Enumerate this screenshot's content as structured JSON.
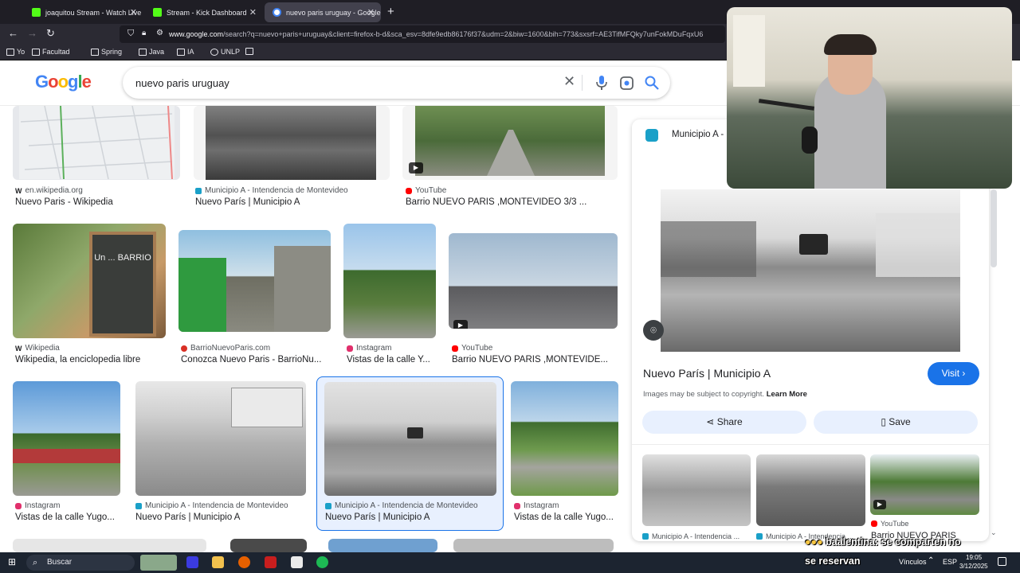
{
  "browser": {
    "tabs": [
      {
        "label": "joaquitou Stream - Watch Live o...",
        "color": "#53fc18"
      },
      {
        "label": "Stream - Kick Dashboard",
        "color": "#53fc18"
      },
      {
        "label": "nuevo paris uruguay - Google S...",
        "color": "#4285f4"
      }
    ],
    "url_domain": "www.google.com",
    "url_rest": "/search?q=nuevo+paris+uruguay&client=firefox-b-d&sca_esv=8dfe9edb86176f37&udm=2&biw=1600&bih=773&sxsrf=AE3TifMFQky7unFokMDuFqxU6",
    "bookmarks": [
      "Yo",
      "Facultad",
      "Spring",
      "Java",
      "IA",
      "UNLP"
    ]
  },
  "search": {
    "logo": "Google",
    "query": "nuevo paris uruguay"
  },
  "colors": {
    "google_blue": "#1a73e8",
    "youtube_red": "#ff0000",
    "instagram": "#e1306c",
    "municipio_teal": "#1aa0c8"
  },
  "results": [
    {
      "source": "en.wikipedia.org",
      "title": "Nuevo Paris - Wikipedia",
      "src_icon": "wikipedia-icon"
    },
    {
      "source": "Municipio A - Intendencia de Montevideo",
      "title": "Nuevo París | Municipio A",
      "src_icon": "municipio-icon"
    },
    {
      "source": "YouTube",
      "title": "Barrio NUEVO PARIS ,MONTEVIDEO 3/3 ...",
      "src_icon": "youtube-icon"
    },
    {
      "source": "Wikipedia",
      "title": "Wikipedia, la enciclopedia libre",
      "src_icon": "wikipedia-icon"
    },
    {
      "source": "BarrioNuevoParis.com",
      "title": "Conozca Nuevo Paris - BarrioNu...",
      "src_icon": "site-icon"
    },
    {
      "source": "Instagram",
      "title": "Vistas de la calle Y...",
      "src_icon": "instagram-icon"
    },
    {
      "source": "YouTube",
      "title": "Barrio NUEVO PARIS ,MONTEVIDE...",
      "src_icon": "youtube-icon"
    },
    {
      "source": "Instagram",
      "title": "Vistas de la calle Yugo...",
      "src_icon": "instagram-icon"
    },
    {
      "source": "Municipio A - Intendencia de Montevideo",
      "title": "Nuevo París | Municipio A",
      "src_icon": "municipio-icon"
    },
    {
      "source": "Municipio A - Intendencia de Montevideo",
      "title": "Nuevo París | Municipio A",
      "src_icon": "municipio-icon"
    },
    {
      "source": "Instagram",
      "title": "Vistas de la calle Yugo...",
      "src_icon": "instagram-icon"
    }
  ],
  "image_text": {
    "chalkboard": "Un ... BARRIO"
  },
  "panel": {
    "source": "Municipio A -",
    "title": "Nuevo París | Municipio A",
    "visit": "Visit",
    "copyright": "Images may be subject to copyright.",
    "learn_more": "Learn More",
    "share": "Share",
    "save": "Save",
    "related": [
      {
        "source": "Municipio A - Intendencia ...",
        "title": ""
      },
      {
        "source": "Municipio A - Intendencia ...",
        "title": ""
      },
      {
        "source": "YouTube",
        "title": "Barrio NUEVO PARIS"
      }
    ]
  },
  "taskbar": {
    "search": "Buscar",
    "links": "Vínculos",
    "lang": "ESP",
    "time": "19:05",
    "date": "3/12/2025"
  },
  "overlay": {
    "chat_user": "baalentina",
    "chat_msg": ": se comparten no",
    "chat_line2": "se reservan"
  }
}
